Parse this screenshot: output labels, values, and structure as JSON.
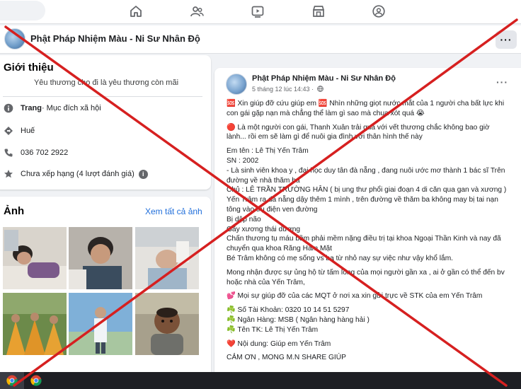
{
  "colors": {
    "accent": "#1877f2",
    "link": "#216fdb",
    "cross": "#d62020",
    "taskbar": "#1e1f24"
  },
  "topnav": {
    "icons": [
      "home-icon",
      "friends-icon",
      "video-icon",
      "marketplace-icon",
      "groups-icon"
    ]
  },
  "page": {
    "name": "Phật Pháp Nhiệm Màu - Ni Sư Nhân Độ",
    "more_label": "···"
  },
  "intro": {
    "title": "Giới thiệu",
    "bio": "Yêu thương cho đi là yêu thương còn mãi",
    "page_type_bold": "Trang",
    "page_type_rest": " · Mục đích xã hội",
    "location": "Huế",
    "phone": "036 702 2922",
    "rating": "Chưa xếp hạng (4 lượt đánh giá)"
  },
  "photos": {
    "title": "Ảnh",
    "see_all": "Xem tất cả ảnh"
  },
  "post": {
    "author": "Phật Pháp Nhiệm Màu - Ni Sư Nhân Độ",
    "time": "5 tháng 12 lúc 14:43 ·",
    "more_label": "···",
    "line1": "🆘 Xin giúp đỡ cứu giúp em 🆘 Nhìn những giọt nước mắt của 1 người cha bất lực khi con gái gặp nạn mà chẳng thể làm gì sao mà chua xót quá 😭",
    "line2": "🔴 Là một người con gái, Thanh Xuân trải qua với vết thương chắc không bao giờ lành... rồi em sẽ làm gì để nuôi gia đình với thân hình thế này",
    "line3": "Em tên : Lê Thị Yến Trâm",
    "line4": "SN : 2002",
    "line5": "- Là sinh viên khoa y , đại học duy tân đà nẵng , đang nuôi ước mơ thành 1 bác sĩ Trên đường về nhà thăm ba",
    "line6": "Chủ : LÊ TRẦN TRƯỜNG HÂN ( bị ung thư phổi giai đoạn 4 di căn qua gan và xương ) Yến Trâm ra đà nẵng dậy thêm 1 mình , trên đường về thăm ba không may bị tai nạn tông vào trụ điện ven đường",
    "line7": "Bị dập não",
    "line8": "Gãy xương thái dương",
    "line9": "Chấn thương tụ máu bầm phải mềm nặng điều trị tại khoa Ngoại Thần Kinh và nay đã chuyển qua khoa Răng Hàm Mặt",
    "line10": "Bé Trâm không có mẹ sống vs ba từ nhỏ nay sự việc như vậy khổ lắm.",
    "line11": "Mong nhận được sự ủng hộ từ tấm lòng của mọi người gần xa , ai ở gần có thể đến bv hoặc nhà của Yến Trâm,",
    "line12": "💕 Mọi sự giúp đỡ của các MQT ở nơi xa xin gửi trực về STK của em Yến Trâm",
    "line13": "☘️ Số Tài Khoản: 0320 10 14 51 5297",
    "line14": "☘️ Ngân Hàng: MSB ( Ngân hàng hàng hải )",
    "line15": "☘️ Tên TK: Lê Thị Yến Trâm",
    "line16": "❤️ Nội dung: Giúp em Yến Trâm",
    "line17": "CẢM ƠN , MONG M.N SHARE GIÚP"
  },
  "taskbar": {
    "icons": [
      "chrome-icon",
      "chrome-icon"
    ]
  }
}
